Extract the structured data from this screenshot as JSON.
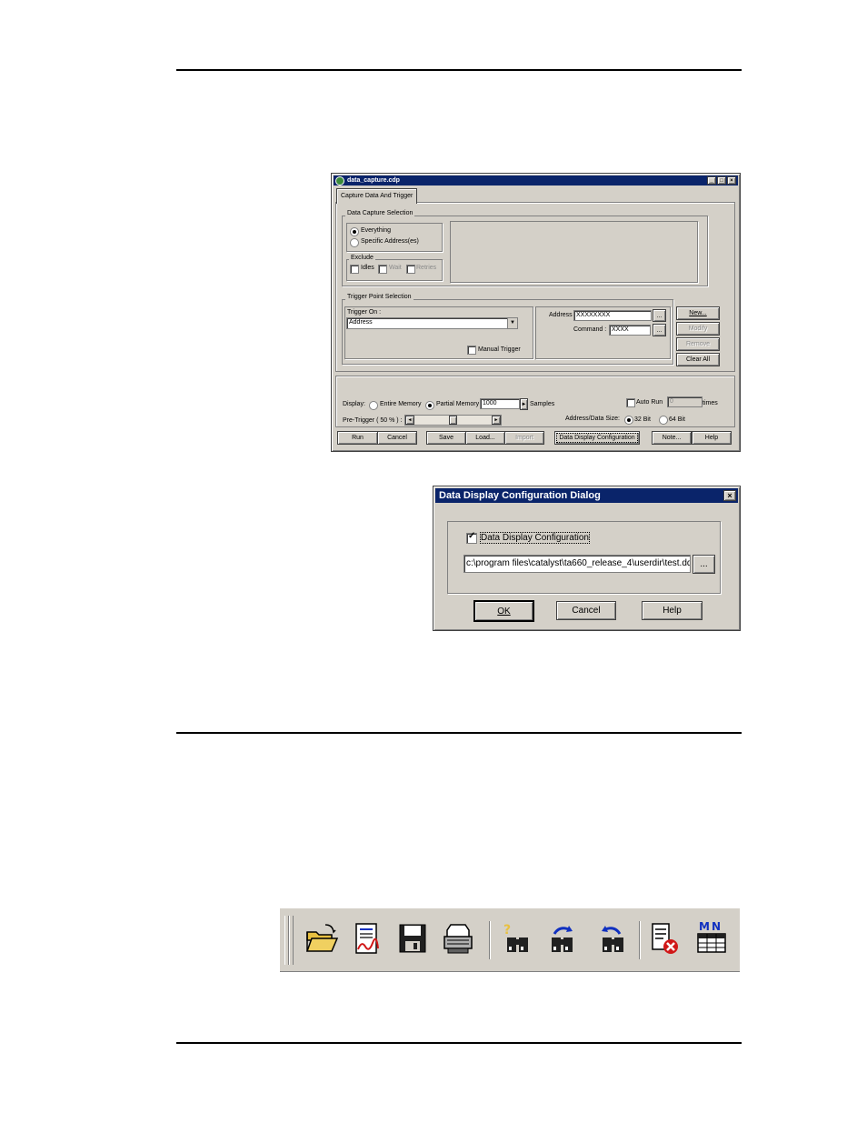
{
  "capture_window": {
    "title": "data_capture.cdp",
    "tab": "Capture Data And Trigger",
    "data_capture_selection": {
      "label": "Data Capture Selection",
      "everything": "Everything",
      "specific": "Specific Address(es)",
      "exclude_label": "Exclude",
      "idles": "Idles",
      "wait": "Wait",
      "retries": "Retries"
    },
    "trigger": {
      "label": "Trigger Point Selection",
      "trigger_on_label": "Trigger On :",
      "trigger_on_value": "Address",
      "manual_trigger": "Manual Trigger",
      "address_label": "Address :",
      "address_value": "XXXXXXXX",
      "command_label": "Command :",
      "command_value": "XXXX",
      "browse": "...",
      "new": "New...",
      "modify": "Modify",
      "remove": "Remove",
      "clear_all": "Clear All"
    },
    "display": {
      "label": "Display:",
      "entire": "Entire Memory",
      "partial": "Partial Memory",
      "samples_value": "1000",
      "samples_label": "Samples",
      "auto_run": "Auto Run",
      "auto_run_value": "0",
      "times": "times",
      "pretrigger": "Pre-Trigger ( 50 % ) :",
      "pretrigger_percent": 50,
      "addr_size_label": "Address/Data Size:",
      "bit32": "32 Bit",
      "bit64": "64 Bit"
    },
    "buttons": {
      "run": "Run",
      "cancel": "Cancel",
      "save": "Save",
      "load": "Load...",
      "import": "Import",
      "ddc": "Data Display Configuration",
      "note": "Note...",
      "help": "Help"
    }
  },
  "ddc_dialog": {
    "title": "Data Display Configuration Dialog",
    "checkbox_label": "Data Display Configuration",
    "path": "c:\\program files\\catalyst\\ta660_release_4\\userdir\\test.ddc",
    "browse": "...",
    "ok": "OK",
    "cancel": "Cancel",
    "help": "Help"
  },
  "toolbar": {
    "icons": [
      "open-folder-icon",
      "open-report-icon",
      "save-disk-icon",
      "print-icon",
      "find-icon",
      "find-next-icon",
      "find-previous-icon",
      "close-document-icon",
      "memory-map-icon"
    ],
    "memory_map_letters": "MN"
  },
  "colors": {
    "titlebar": "#0a246a",
    "face": "#d4d0c8",
    "folder": "#e8c040",
    "red": "#d01818"
  }
}
